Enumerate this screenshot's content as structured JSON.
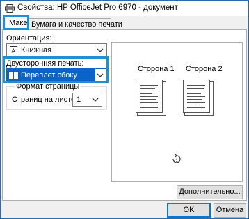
{
  "window": {
    "title": "Свойства: HP OfficeJet Pro 6970 - документ"
  },
  "tabs": [
    {
      "label": "Макет",
      "active": true
    },
    {
      "label": "Бумага и качество печати",
      "active": false
    }
  ],
  "orientation": {
    "label": "Ориентация:",
    "value": "Книжная"
  },
  "duplex": {
    "label": "Двусторонняя печать:",
    "value": "Переплет сбоку"
  },
  "page_format": {
    "group_label": "Формат страницы",
    "pages_per_sheet_label": "Страниц на листе",
    "pages_per_sheet_value": "1"
  },
  "preview": {
    "side1_label": "Сторона 1",
    "side2_label": "Сторона 2"
  },
  "buttons": {
    "advanced": "Дополнительно...",
    "ok": "OK",
    "cancel": "Отмена"
  },
  "accent_color": "#1f8fd6"
}
